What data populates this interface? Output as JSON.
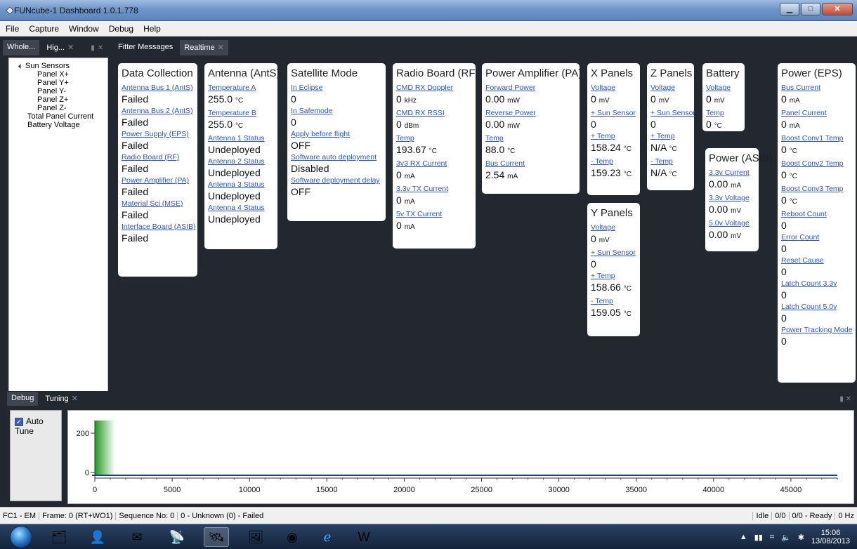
{
  "window": {
    "title": "FUNcube-1 Dashboard 1.0.1.778"
  },
  "menu": [
    "File",
    "Capture",
    "Window",
    "Debug",
    "Help"
  ],
  "left_tabs": [
    "Whole...",
    "Hig..."
  ],
  "doc_tabs": [
    "Fitter Messages",
    "Realtime"
  ],
  "tree": {
    "root": "Sun Sensors",
    "children": [
      "Panel X+",
      "Panel Y+",
      "Panel Y-",
      "Panel Z+",
      "Panel Z-"
    ],
    "extra": [
      "Total Panel Current",
      "Battery Voltage"
    ]
  },
  "cards": {
    "data_collection": {
      "title": "Data Collection",
      "rows": [
        {
          "label": "Antenna Bus 1 (AntS)",
          "value": "Failed",
          "unit": ""
        },
        {
          "label": "Antenna Bus 2 (AntS)",
          "value": "Failed",
          "unit": ""
        },
        {
          "label": "Power Supply (EPS)",
          "value": "Failed",
          "unit": ""
        },
        {
          "label": "Radio Board (RF)",
          "value": "Failed",
          "unit": ""
        },
        {
          "label": "Power Amplifier (PA)",
          "value": "Failed",
          "unit": ""
        },
        {
          "label": "Material Sci (MSE)",
          "value": "Failed",
          "unit": ""
        },
        {
          "label": "Interface Board (ASIB)",
          "value": "Failed",
          "unit": ""
        }
      ]
    },
    "antenna": {
      "title": "Antenna (AntS)",
      "rows": [
        {
          "label": "Temperature A",
          "value": "255.0",
          "unit": "°C"
        },
        {
          "label": "Temperature B",
          "value": "255.0",
          "unit": "°C"
        },
        {
          "label": "Antenna 1 Status",
          "value": "Undeployed",
          "unit": ""
        },
        {
          "label": "Antenna 2 Status",
          "value": "Undeployed",
          "unit": ""
        },
        {
          "label": "Antenna 3 Status",
          "value": "Undeployed",
          "unit": ""
        },
        {
          "label": "Antenna 4 Status",
          "value": "Undeployed",
          "unit": ""
        }
      ]
    },
    "satellite_mode": {
      "title": "Satellite Mode",
      "rows": [
        {
          "label": "In Eclipse",
          "value": "0",
          "unit": ""
        },
        {
          "label": "In Safemode",
          "value": "0",
          "unit": ""
        },
        {
          "label": "Apply before flight",
          "value": "OFF",
          "unit": ""
        },
        {
          "label": "Software auto deployment",
          "value": "Disabled",
          "unit": ""
        },
        {
          "label": "Software deployment delay",
          "value": "OFF",
          "unit": ""
        }
      ]
    },
    "radio_board": {
      "title": "Radio Board (RF)",
      "rows": [
        {
          "label": "CMD RX Doppler",
          "value": "0",
          "unit": "kHz"
        },
        {
          "label": "CMD RX RSSI",
          "value": "0",
          "unit": "dBm"
        },
        {
          "label": "Temp",
          "value": "193.67",
          "unit": "°C"
        },
        {
          "label": "3v3 RX Current",
          "value": "0",
          "unit": "mA"
        },
        {
          "label": "3.3v TX Current",
          "value": "0",
          "unit": "mA"
        },
        {
          "label": "5v TX Current",
          "value": "0",
          "unit": "mA"
        }
      ]
    },
    "power_amp": {
      "title": "Power Amplifier (PA)",
      "rows": [
        {
          "label": "Forward Power",
          "value": "0.00",
          "unit": "mW"
        },
        {
          "label": "Reverse Power",
          "value": "0.00",
          "unit": "mW"
        },
        {
          "label": "Temp",
          "value": "88.0",
          "unit": "°C"
        },
        {
          "label": "Bus Current",
          "value": "2.54",
          "unit": "mA"
        }
      ]
    },
    "x_panels": {
      "title": "X Panels",
      "rows": [
        {
          "label": "Voltage",
          "value": "0",
          "unit": "mV"
        },
        {
          "label": "+ Sun Sensor",
          "value": "0",
          "unit": ""
        },
        {
          "label": "+ Temp",
          "value": "158.24",
          "unit": "°C"
        },
        {
          "label": "- Temp",
          "value": "159.23",
          "unit": "°C"
        }
      ]
    },
    "y_panels": {
      "title": "Y Panels",
      "rows": [
        {
          "label": "Voltage",
          "value": "0",
          "unit": "mV"
        },
        {
          "label": "+ Sun Sensor",
          "value": "0",
          "unit": ""
        },
        {
          "label": "+ Temp",
          "value": "158.66",
          "unit": "°C"
        },
        {
          "label": "- Temp",
          "value": "159.05",
          "unit": "°C"
        }
      ]
    },
    "z_panels": {
      "title": "Z Panels",
      "rows": [
        {
          "label": "Voltage",
          "value": "0",
          "unit": "mV"
        },
        {
          "label": "+ Sun Sensor",
          "value": "0",
          "unit": ""
        },
        {
          "label": "+ Temp",
          "value": "N/A",
          "unit": "°C"
        },
        {
          "label": "- Temp",
          "value": "N/A",
          "unit": "°C"
        }
      ]
    },
    "battery": {
      "title": "Battery",
      "rows": [
        {
          "label": "Voltage",
          "value": "0",
          "unit": "mV"
        },
        {
          "label": "Temp",
          "value": "0",
          "unit": "°C"
        }
      ]
    },
    "power_asib": {
      "title": "Power (ASIB)",
      "rows": [
        {
          "label": "3.3v Current",
          "value": "0.00",
          "unit": "mA"
        },
        {
          "label": "3.3v Voltage",
          "value": "0.00",
          "unit": "mV"
        },
        {
          "label": "5.0v Voltage",
          "value": "0.00",
          "unit": "mV"
        }
      ]
    },
    "power_eps": {
      "title": "Power (EPS)",
      "rows": [
        {
          "label": "Bus Current",
          "value": "0",
          "unit": "mA"
        },
        {
          "label": "Panel Current",
          "value": "0",
          "unit": "mA"
        },
        {
          "label": "Boost Conv1 Temp",
          "value": "0",
          "unit": "°C"
        },
        {
          "label": "Boost Conv2 Temp",
          "value": "0",
          "unit": "°C"
        },
        {
          "label": "Boost Conv3 Temp",
          "value": "0",
          "unit": "°C"
        },
        {
          "label": "Reboot Count",
          "value": "0",
          "unit": ""
        },
        {
          "label": "Error Count",
          "value": "0",
          "unit": ""
        },
        {
          "label": "Reset Cause",
          "value": "0",
          "unit": ""
        },
        {
          "label": "Latch Count 3.3v",
          "value": "0",
          "unit": ""
        },
        {
          "label": "Latch Count 5.0v",
          "value": "0",
          "unit": ""
        },
        {
          "label": "Power Tracking Mode",
          "value": "0",
          "unit": ""
        }
      ]
    }
  },
  "bottom_tabs": [
    "Debug",
    "Tuning"
  ],
  "tuning": {
    "auto_tune_label": "Auto Tune",
    "auto_tune_checked": true
  },
  "chart_data": {
    "type": "area",
    "x_ticks": [
      0,
      5000,
      10000,
      15000,
      20000,
      25000,
      30000,
      35000,
      40000,
      45000
    ],
    "y_ticks": [
      0,
      200
    ],
    "xlim": [
      0,
      48000
    ],
    "ylim": [
      0,
      260
    ],
    "signal_region": [
      0,
      1300
    ],
    "signal_color": "#1f9a1f",
    "baseline_color": "#1a3f8f"
  },
  "status": {
    "left": [
      "FC1 - EM",
      "Frame: 0 (RT+WO1)",
      "Sequence No: 0",
      "0 - Unknown (0) - Failed"
    ],
    "right": [
      "Idle",
      "0/0",
      "0/0 - Ready",
      "0 Hz"
    ]
  },
  "taskbar": {
    "time": "15:06",
    "date": "13/08/2013"
  }
}
